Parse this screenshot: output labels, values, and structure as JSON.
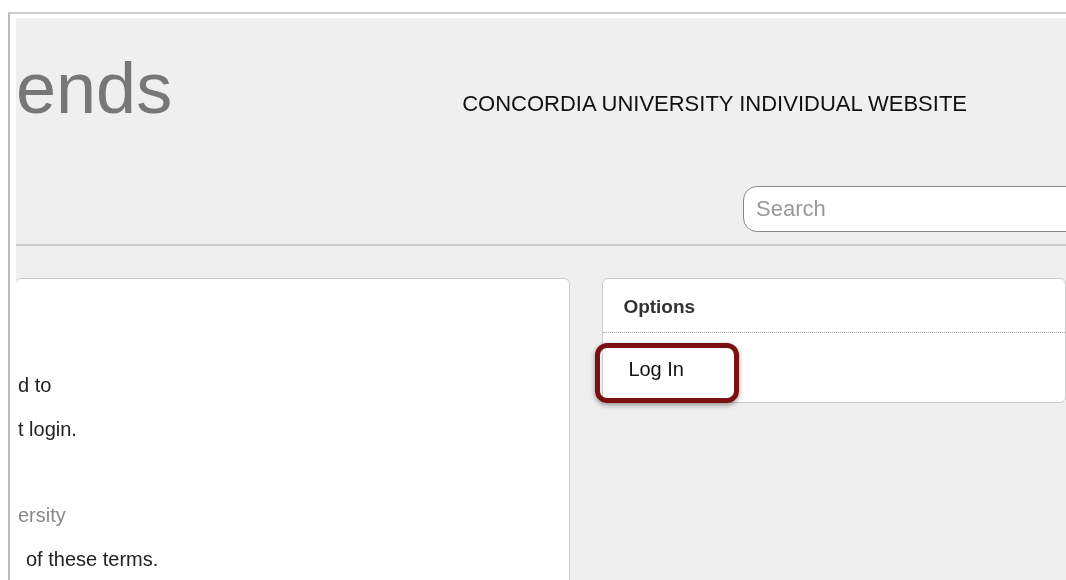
{
  "header": {
    "title": "ends",
    "site_name": "CONCORDIA UNIVERSITY INDIVIDUAL WEBSITE",
    "search": {
      "placeholder": "Search"
    }
  },
  "content": {
    "lines": [
      {
        "text": "d to",
        "kind": "normal"
      },
      {
        "text": "t login.",
        "kind": "normal"
      },
      {
        "text": "ersity",
        "kind": "muted"
      },
      {
        "text": "of these terms.",
        "kind": "normal"
      }
    ]
  },
  "options": {
    "title": "Options",
    "items": [
      {
        "label": "Log In",
        "highlighted": true
      }
    ]
  }
}
